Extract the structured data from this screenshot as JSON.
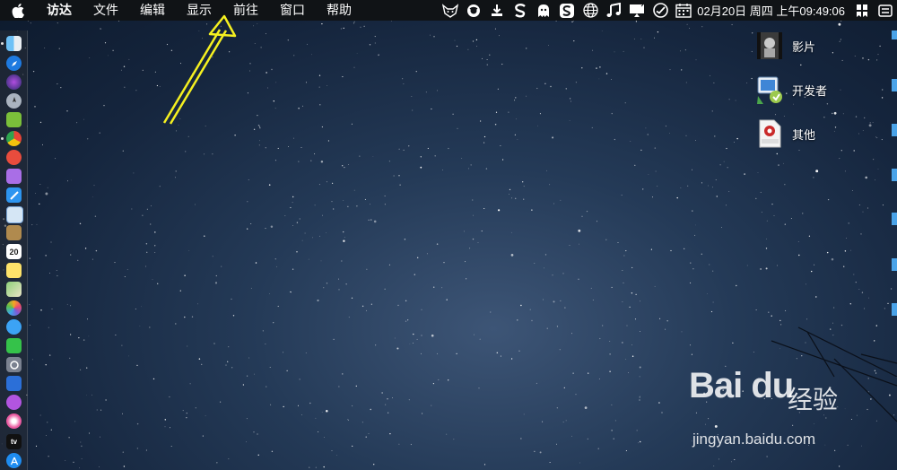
{
  "menubar": {
    "app_name": "访达",
    "items": [
      "文件",
      "编辑",
      "显示",
      "前往",
      "窗口",
      "帮助"
    ],
    "clock": "02月20日 周四 上午09:49:06"
  },
  "status_icons": [
    "fox-icon",
    "steering-icon",
    "download-icon",
    "s-app-icon",
    "ghost-icon",
    "s-box-icon",
    "globe-icon",
    "music-note-icon",
    "display-icon",
    "checkmark-circle-icon",
    "calendar-icon"
  ],
  "desktop": {
    "items": [
      {
        "label": "影片"
      },
      {
        "label": "开发者"
      },
      {
        "label": "其他"
      }
    ]
  },
  "dock": {
    "calendar_day": "20",
    "appletv_label": "tv",
    "apps": [
      "finder",
      "safari",
      "siri",
      "launchpad",
      "android-studio",
      "chrome",
      "to-do",
      "notes-purple",
      "xcode",
      "preview",
      "notebook",
      "calendar",
      "stickies",
      "maps",
      "photos",
      "messages",
      "facetime",
      "system-preferences",
      "keynote",
      "podcasts",
      "itunes",
      "apple-tv",
      "app-store"
    ]
  },
  "watermark": {
    "logo": "Bai du",
    "cn": "经验",
    "url": "jingyan.baidu.com"
  },
  "colors": {
    "menubar": "#101316",
    "arrow": "#f5f020",
    "sky_light": "#3d5576",
    "sky_dark": "#0d1a2d"
  }
}
